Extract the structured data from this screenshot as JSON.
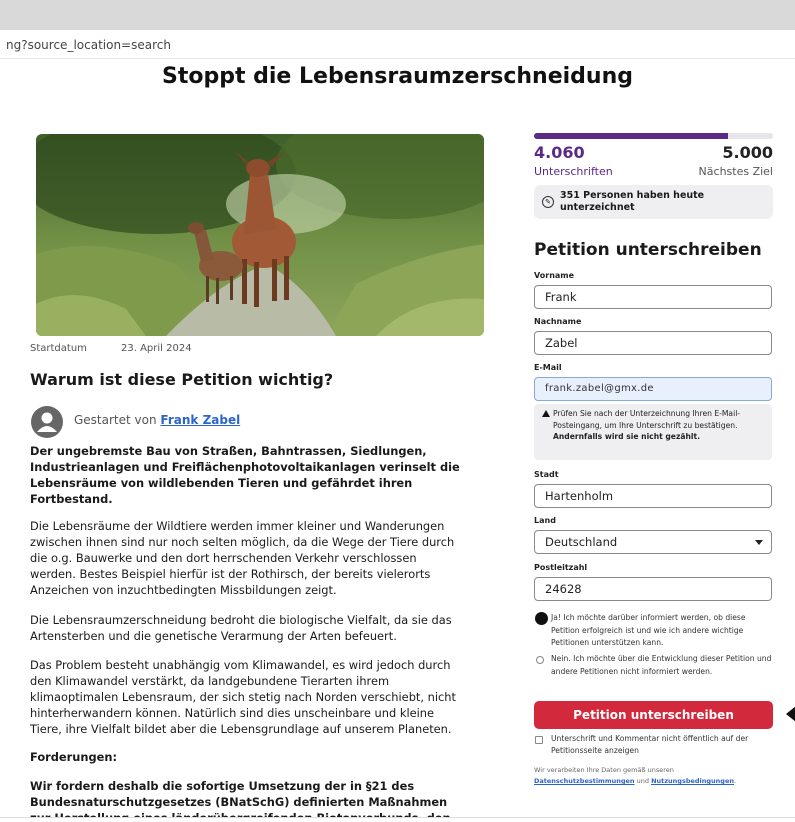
{
  "browser": {
    "url_fragment": "ng?source_location=search"
  },
  "petition": {
    "title": "Stoppt die Lebensraumzerschneidung",
    "start_label": "Startdatum",
    "start_date": "23. April 2024",
    "why_heading": "Warum ist diese Petition wichtig?",
    "started_by_label": "Gestartet von",
    "author": "Frank Zabel",
    "paragraphs": {
      "intro": "Der ungebremste Bau von Straßen, Bahntrassen, Siedlungen, Industrieanlagen und Freiflächenphotovoltaikanlagen verinselt die Lebensräume von wildlebenden Tieren und gefährdet ihren Fortbestand.",
      "p2": "Die Lebensräume der Wildtiere werden immer kleiner und Wanderungen zwischen ihnen sind nur noch selten möglich, da die Wege der Tiere durch die o.g. Bauwerke und den dort herrschenden Verkehr verschlossen werden. Bestes Beispiel hierfür ist der Rothirsch, der bereits vielerorts Anzeichen von inzuchtbedingten Missbildungen zeigt.",
      "p3": "Die Lebensraumzerschneidung bedroht die biologische Vielfalt, da sie das Artensterben und die genetische Verarmung der Arten befeuert.",
      "p4": "Das Problem besteht unabhängig vom Klimawandel, es wird jedoch durch den Klimawandel verstärkt, da landgebundene Tierarten ihrem klimaoptimalen Lebensraum, der sich stetig nach Norden verschiebt, nicht hinterherwandern können. Natürlich sind dies unscheinbare und kleine Tiere, ihre Vielfalt bildet aber die Lebensgrundlage auf unserem Planeten.",
      "demands_heading": "Forderungen:",
      "demands": "Wir fordern deshalb die sofortige Umsetzung der in §21 des Bundesnaturschutzgesetzes (BNatSchG) definierten Maßnahmen zur Herstellung eines länderübergreifenden Biotopverbunds, den Schutz der"
    }
  },
  "progress": {
    "count": "4.060",
    "goal": "5.000",
    "count_label": "Unterschriften",
    "goal_label": "Nächstes Ziel",
    "fraction": 0.812,
    "today_text": "351 Personen haben heute unterzeichnet"
  },
  "form": {
    "heading": "Petition unterschreiben",
    "first_name_label": "Vorname",
    "first_name": "Frank",
    "last_name_label": "Nachname",
    "last_name": "Zabel",
    "email_label": "E-Mail",
    "email": "frank.zabel@gmx.de",
    "notice": "Prüfen Sie nach der Unterzeichnung Ihren E-Mail-Posteingang, um Ihre Unterschrift zu bestätigen.",
    "notice_bold": "Andernfalls wird sie nicht gezählt.",
    "city_label": "Stadt",
    "city": "Hartenholm",
    "country_label": "Land",
    "country": "Deutschland",
    "zip_label": "Postleitzahl",
    "zip": "24628",
    "opt_in": "Ja! Ich möchte darüber informiert werden, ob diese Petition erfolgreich ist und wie ich andere wichtige Petitionen unterstützen kann.",
    "opt_out": "Nein. Ich möchte über die Entwicklung dieser Petition und andere Petitionen nicht informiert werden.",
    "submit_label": "Petition unterschreiben",
    "private_label": "Unterschrift und Kommentar nicht öffentlich auf der Petitionsseite anzeigen",
    "privacy_text": "Wir verarbeiten Ihre Daten gemäß unseren",
    "privacy_link": "Datenschutzbestimmungen",
    "privacy_and": "und",
    "terms_link": "Nutzungsbedingungen",
    "privacy_end": "."
  },
  "colors": {
    "accent": "#5a2a86",
    "submit": "#d3293c",
    "link": "#2c65c9"
  }
}
